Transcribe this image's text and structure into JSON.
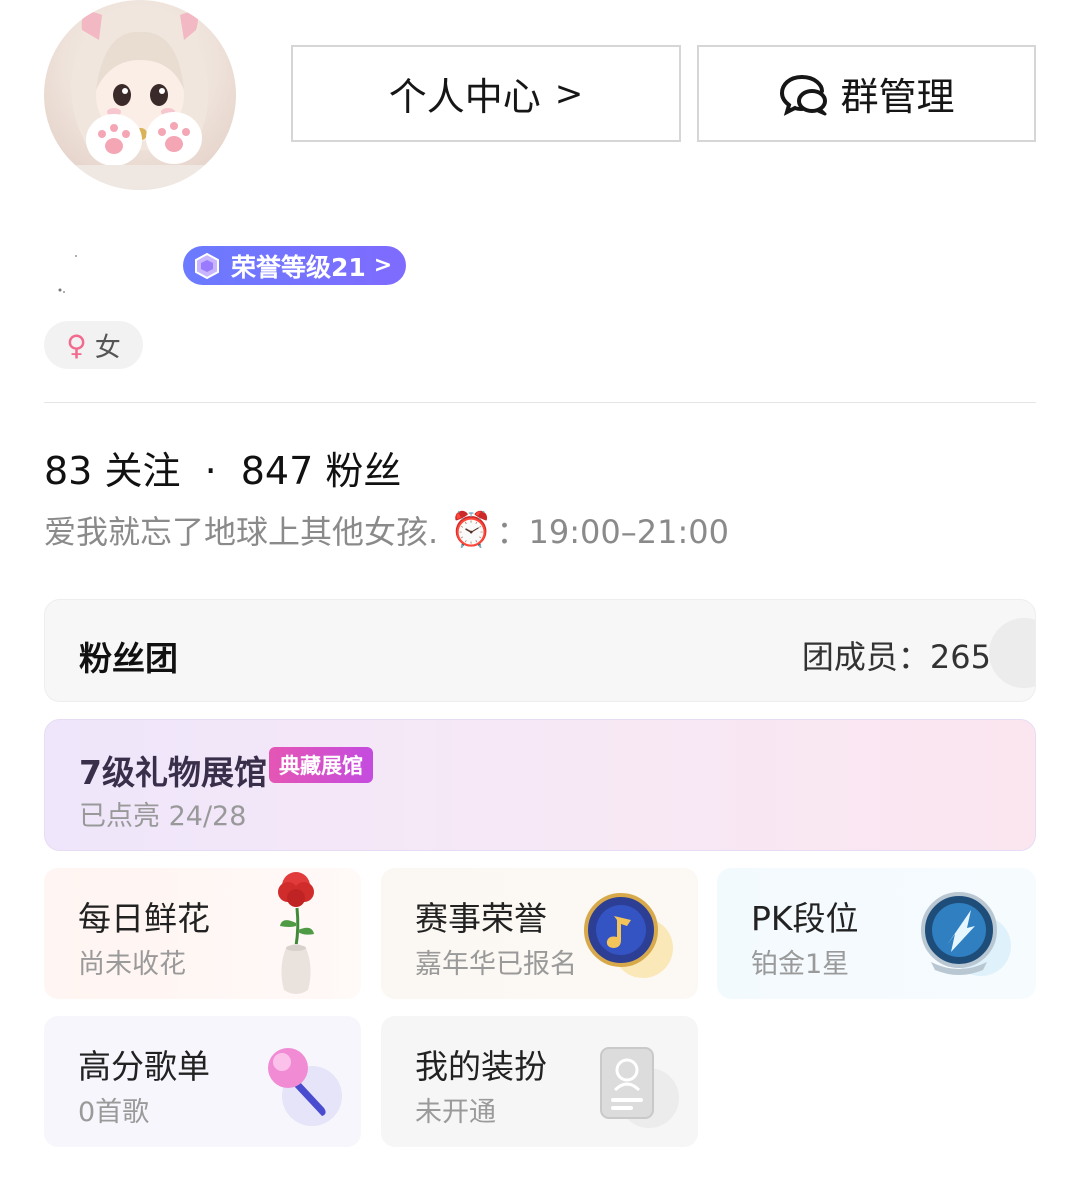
{
  "header": {
    "personal_center_label": "个人中心",
    "group_manage_label": "群管理"
  },
  "profile": {
    "honor_badge": "荣誉等级21",
    "gender_label": "女",
    "gender_icon": "female-icon",
    "following_count": "83",
    "following_label": "关注",
    "separator": "·",
    "followers_count": "847",
    "followers_label": "粉丝",
    "bio_text": "爱我就忘了地球上其他女孩.",
    "bio_clock": "⏰",
    "bio_time": "：19:00–21:00"
  },
  "fan_club": {
    "title": "粉丝团",
    "members_label": "团成员：",
    "members_count": "265"
  },
  "gift_hall": {
    "title": "7级礼物展馆",
    "tag": "典藏展馆",
    "progress": "已点亮 24/28"
  },
  "tiles": [
    {
      "title": "每日鲜花",
      "subtitle": "尚未收花",
      "icon": "flower-vase-icon"
    },
    {
      "title": "赛事荣誉",
      "subtitle": "嘉年华已报名",
      "icon": "music-note-medal-icon"
    },
    {
      "title": "PK段位",
      "subtitle": "铂金1星",
      "icon": "pk-rank-badge-icon"
    },
    {
      "title": "高分歌单",
      "subtitle": "0首歌",
      "icon": "microphone-icon"
    },
    {
      "title": "我的装扮",
      "subtitle": "未开通",
      "icon": "id-card-icon"
    }
  ],
  "colors": {
    "honor_badge": "#7073ff",
    "gender_symbol": "#f26a8d",
    "gift_tag": "#d94fc8"
  }
}
